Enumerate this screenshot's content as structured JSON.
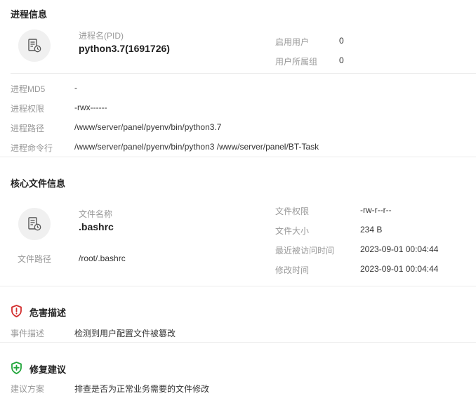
{
  "process_section": {
    "title": "进程信息",
    "name_label": "进程名(PID)",
    "name_value": "python3.7(1691726)",
    "user_label": "启用用户",
    "user_value": "0",
    "group_label": "用户所属组",
    "group_value": "0",
    "rows": [
      {
        "label": "进程MD5",
        "value": "-"
      },
      {
        "label": "进程权限",
        "value": "-rwx------"
      },
      {
        "label": "进程路径",
        "value": "/www/server/panel/pyenv/bin/python3.7"
      },
      {
        "label": "进程命令行",
        "value": "/www/server/panel/pyenv/bin/python3 /www/server/panel/BT-Task"
      }
    ]
  },
  "file_section": {
    "title": "核心文件信息",
    "name_label": "文件名称",
    "name_value": ".bashrc",
    "path_label": "文件路径",
    "path_value": "/root/.bashrc",
    "perm_label": "文件权限",
    "perm_value": "-rw-r--r--",
    "size_label": "文件大小",
    "size_value": "234 B",
    "access_label": "最近被访问时间",
    "access_value": "2023-09-01 00:04:44",
    "modify_label": "修改时间",
    "modify_value": "2023-09-01 00:04:44"
  },
  "harm_section": {
    "title": "危害描述",
    "icon": "shield-alert-icon",
    "icon_color": "#d32f2f",
    "label": "事件描述",
    "value": "检测到用户配置文件被篡改"
  },
  "fix_section": {
    "title": "修复建议",
    "icon": "shield-plus-icon",
    "icon_color": "#20a53a",
    "label": "建议方案",
    "value": "排查是否为正常业务需要的文件修改"
  }
}
